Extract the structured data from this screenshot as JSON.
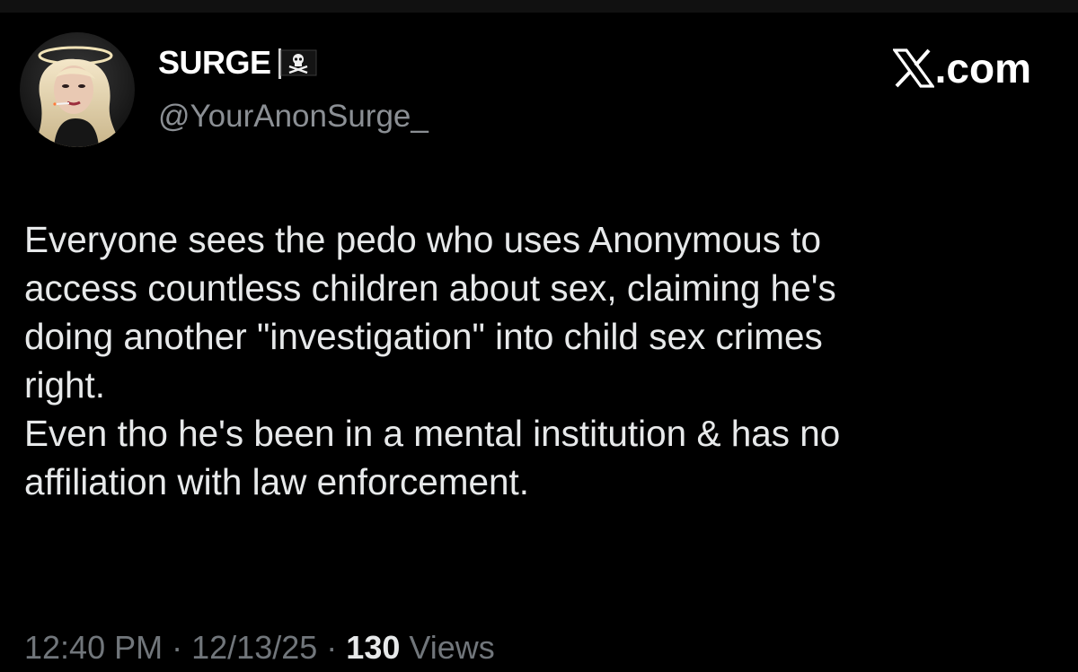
{
  "author": {
    "display_name": "SURGE",
    "handle": "@YourAnonSurge_",
    "flag_icon": "pirate-flag-icon"
  },
  "brand": {
    "icon": "x-logo-icon",
    "suffix": ".com"
  },
  "tweet": {
    "text": "Everyone sees the pedo who uses Anonymous to\naccess countless children about sex, claiming he's\ndoing another \"investigation\" into child sex crimes\nright.\nEven tho he's been in a mental institution & has no\naffiliation with law enforcement."
  },
  "meta": {
    "time": "12:40 PM",
    "separator": "·",
    "date": "12/13/25",
    "views_count": "130",
    "views_label": "Views"
  },
  "colors": {
    "background": "#000000",
    "text": "#e7e9ea",
    "secondary_text": "#71767b"
  }
}
